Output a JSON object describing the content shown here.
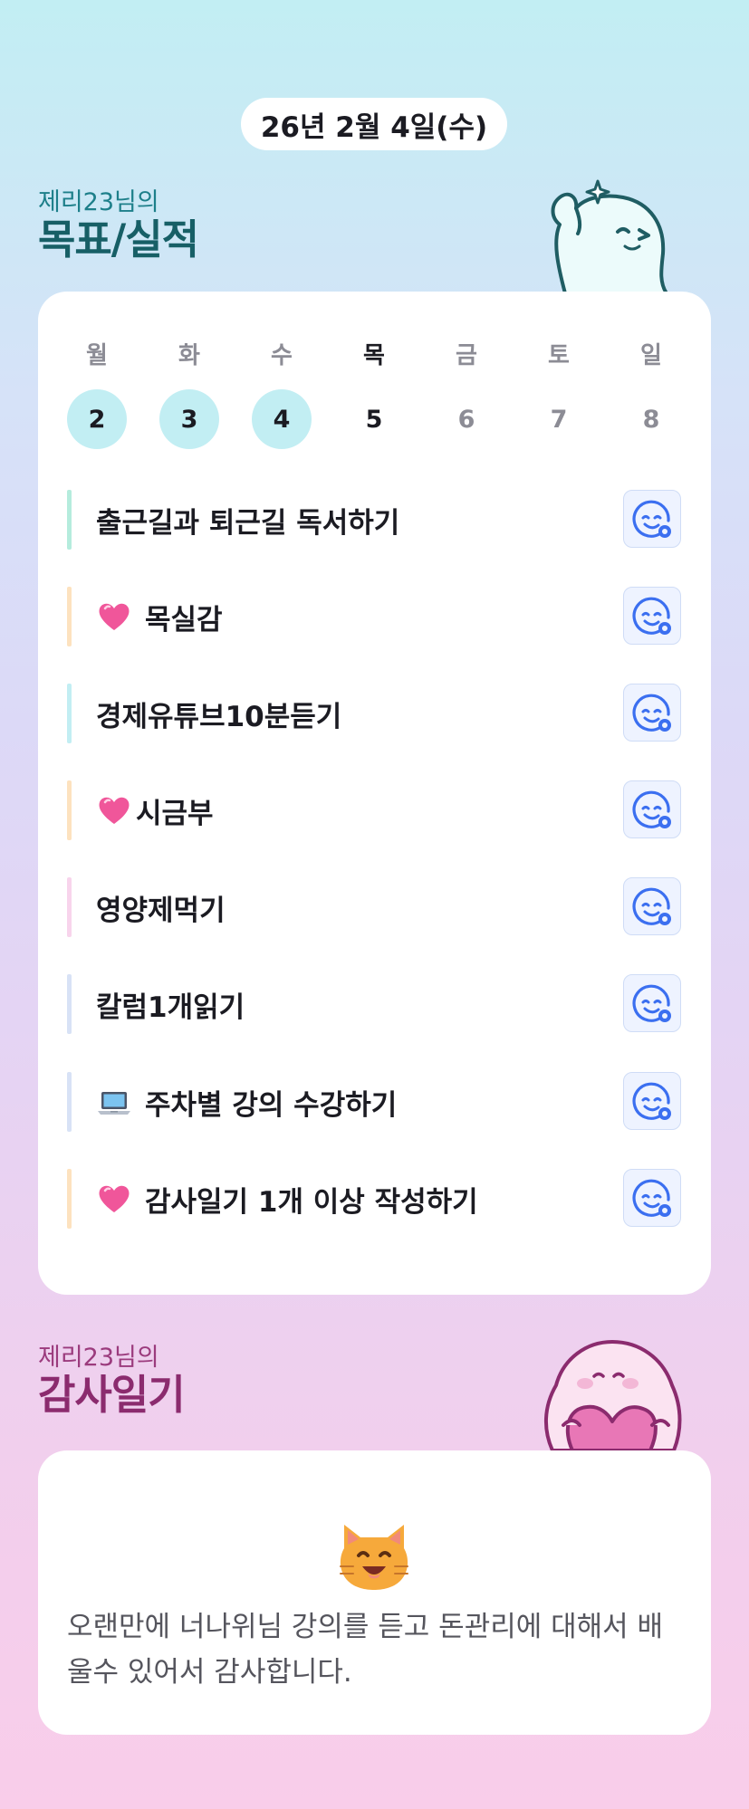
{
  "header": {
    "date": "26년 2월 4일(수)"
  },
  "goals_section": {
    "subtitle": "제리23님의",
    "title": "목표/실적"
  },
  "calendar": {
    "weekdays": [
      "월",
      "화",
      "수",
      "목",
      "금",
      "토",
      "일"
    ],
    "days": [
      "2",
      "3",
      "4",
      "5",
      "6",
      "7",
      "8"
    ],
    "completed_days": [
      "2",
      "3",
      "4"
    ],
    "today": "5"
  },
  "goals": [
    {
      "label": "출근길과 퇴근길 독서하기",
      "emoji": "",
      "bar_color": "#b5ecdd"
    },
    {
      "label": "목실감",
      "emoji": "heart-icon",
      "bar_color": "#fde2bf"
    },
    {
      "label": "경제유튜브10분듣기",
      "emoji": "",
      "bar_color": "#c2eef3"
    },
    {
      "label": "시금부",
      "emoji": "heart-icon",
      "bar_color": "#fde2bf"
    },
    {
      "label": "영양제먹기",
      "emoji": "",
      "bar_color": "#f8d4ec"
    },
    {
      "label": "칼럼1개읽기",
      "emoji": "",
      "bar_color": "#d8e2f6"
    },
    {
      "label": "주차별 강의 수강하기",
      "emoji": "laptop-icon",
      "bar_color": "#d8e2f6"
    },
    {
      "label": "감사일기 1개 이상 작성하기",
      "emoji": "heart-icon",
      "bar_color": "#fde2bf"
    }
  ],
  "diary_section": {
    "subtitle": "제리23님의",
    "title": "감사일기"
  },
  "diary": {
    "emoji": "cat-face-icon",
    "text": "오랜만에 너나위님 강의를 듣고 돈관리에 대해서 배울수 있어서 감사합니다."
  },
  "colors": {
    "accent": "#3b6ff0",
    "done_day": "#c2eef3",
    "goals_title": "#175f66",
    "diary_title": "#8b2b6e"
  }
}
